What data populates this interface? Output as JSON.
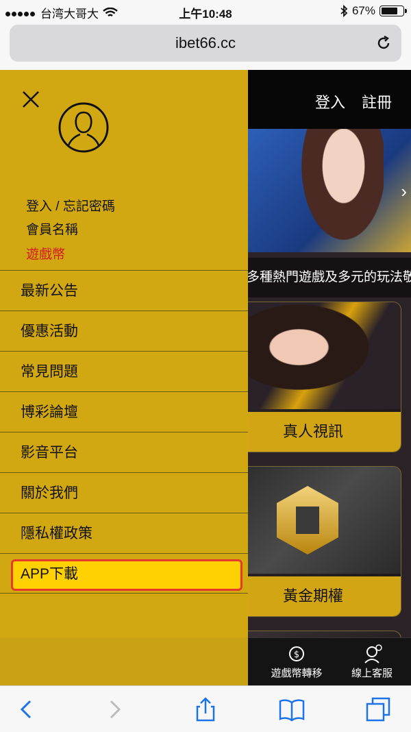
{
  "status_bar": {
    "carrier": "台湾大哥大",
    "time": "上午10:48",
    "battery": "67%",
    "battery_level": 0.67
  },
  "browser": {
    "url": "ibet66.cc"
  },
  "page": {
    "nav": {
      "login": "登入",
      "register": "註冊"
    },
    "marquee": "多種熱門遊戲及多元的玩法敬請期",
    "cards": [
      "真人視訊",
      "黃金期權"
    ],
    "bottom_bar": [
      "遊戲幣轉移",
      "線上客服"
    ]
  },
  "drawer": {
    "account_links": [
      "登入 / 忘記密碼",
      "會員名稱",
      "遊戲幣"
    ],
    "menu_items": [
      "最新公告",
      "優惠活動",
      "常見問題",
      "博彩論壇",
      "影音平台",
      "關於我們",
      "隱私權政策",
      "APP下載"
    ],
    "highlight_color": "#e53a2a",
    "drawer_color": "#d2a812"
  }
}
